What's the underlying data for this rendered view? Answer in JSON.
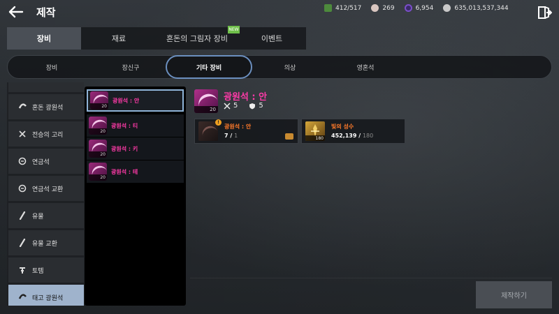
{
  "header": {
    "title": "제작",
    "currencies": [
      {
        "icon": "energy-icon",
        "value": "412/517"
      },
      {
        "icon": "pearl-icon",
        "value": "269"
      },
      {
        "icon": "crystal-icon",
        "value": "6,954"
      },
      {
        "icon": "silver-coin-icon",
        "value": "635,013,537,344"
      }
    ]
  },
  "main_tabs": [
    {
      "label": "장비",
      "active": true
    },
    {
      "label": "재료",
      "active": false
    },
    {
      "label": "혼돈의 그림자 장비",
      "active": false,
      "badge": "NEW"
    },
    {
      "label": "이벤트",
      "active": false
    }
  ],
  "sub_tabs": [
    {
      "label": "장비",
      "active": false
    },
    {
      "label": "장신구",
      "active": false
    },
    {
      "label": "기타 장비",
      "active": true
    },
    {
      "label": "의상",
      "active": false
    },
    {
      "label": "영혼석",
      "active": false
    }
  ],
  "categories": [
    {
      "label": "혼돈 광원석",
      "icon": "gem-icon",
      "active": false
    },
    {
      "label": "전승의 고리",
      "icon": "crossed-swords-icon",
      "active": false
    },
    {
      "label": "연금석",
      "icon": "stone-icon",
      "active": false
    },
    {
      "label": "연금석 교환",
      "icon": "stone-icon",
      "active": false
    },
    {
      "label": "유물",
      "icon": "feather-icon",
      "active": false
    },
    {
      "label": "유물 교환",
      "icon": "feather-icon",
      "active": false
    },
    {
      "label": "토템",
      "icon": "totem-icon",
      "active": false
    },
    {
      "label": "태고 광원석",
      "icon": "gem-icon",
      "active": true
    }
  ],
  "items": [
    {
      "name": "광원석 : 안",
      "level": "20",
      "selected": true
    },
    {
      "name": "광원석 : 티",
      "level": "20",
      "selected": false
    },
    {
      "name": "광원석 : 키",
      "level": "20",
      "selected": false
    },
    {
      "name": "광원석 : 테",
      "level": "20",
      "selected": false
    }
  ],
  "detail": {
    "title": "광원석 : 안",
    "level": "20",
    "attack": "5",
    "defense": "5",
    "materials": [
      {
        "name": "광원석 : 안",
        "have": "7",
        "need": "1",
        "level": "",
        "warn": "!"
      },
      {
        "name": "빛의 성수",
        "have": "452,139",
        "need": "180",
        "level": "180"
      }
    ]
  },
  "craft_button": "제작하기",
  "colors": {
    "item_name": "#ff3aa8",
    "material_name": "#ff7a2a",
    "active_category": "#9fb3cc",
    "active_subtab_border": "#6b8fbf"
  }
}
